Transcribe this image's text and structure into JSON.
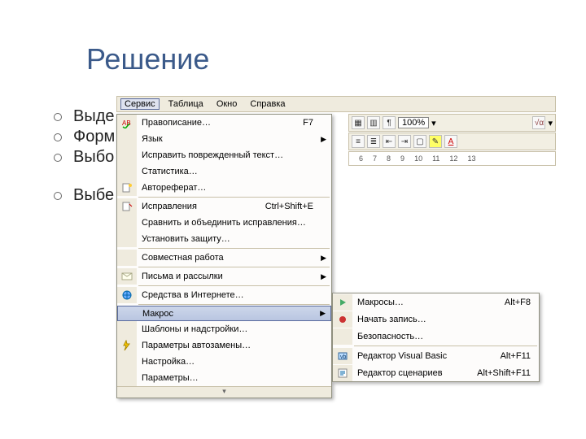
{
  "slide": {
    "title": "Решение",
    "bullets": [
      "Выде",
      "Форм",
      "Выбо",
      "Выбе"
    ]
  },
  "menubar": {
    "items": [
      "Сервис",
      "Таблица",
      "Окно",
      "Справка"
    ],
    "selected_index": 0
  },
  "toolbar1": {
    "zoom": "100%"
  },
  "ruler": {
    "marks": [
      "6",
      "7",
      "8",
      "9",
      "10",
      "11",
      "12",
      "13"
    ]
  },
  "dropdown": {
    "items": [
      {
        "label": "Правописание…",
        "shortcut": "F7",
        "icon": "check-abc"
      },
      {
        "label": "Язык",
        "submenu": true
      },
      {
        "label": "Исправить поврежденный текст…"
      },
      {
        "label": "Статистика…"
      },
      {
        "label": "Автореферат…",
        "icon": "page-sparkle"
      },
      {
        "sep": true
      },
      {
        "label": "Исправления",
        "shortcut": "Ctrl+Shift+E",
        "icon": "redline"
      },
      {
        "label": "Сравнить и объединить исправления…"
      },
      {
        "label": "Установить защиту…"
      },
      {
        "sep": true
      },
      {
        "label": "Совместная работа",
        "submenu": true
      },
      {
        "sep": true
      },
      {
        "label": "Письма и рассылки",
        "submenu": true,
        "icon": "envelope"
      },
      {
        "sep": true
      },
      {
        "label": "Средства в Интернете…",
        "icon": "globe"
      },
      {
        "sep": true
      },
      {
        "label": "Макрос",
        "submenu": true,
        "highlight": true
      },
      {
        "label": "Шаблоны и надстройки…"
      },
      {
        "label": "Параметры автозамены…",
        "icon": "lightning"
      },
      {
        "label": "Настройка…"
      },
      {
        "label": "Параметры…"
      }
    ]
  },
  "submenu": {
    "items": [
      {
        "label": "Макросы…",
        "shortcut": "Alt+F8",
        "icon": "play"
      },
      {
        "label": "Начать запись…",
        "icon": "record"
      },
      {
        "label": "Безопасность…"
      },
      {
        "sep": true
      },
      {
        "label": "Редактор Visual Basic",
        "shortcut": "Alt+F11",
        "icon": "vb"
      },
      {
        "label": "Редактор сценариев",
        "shortcut": "Alt+Shift+F11",
        "icon": "script"
      }
    ]
  }
}
